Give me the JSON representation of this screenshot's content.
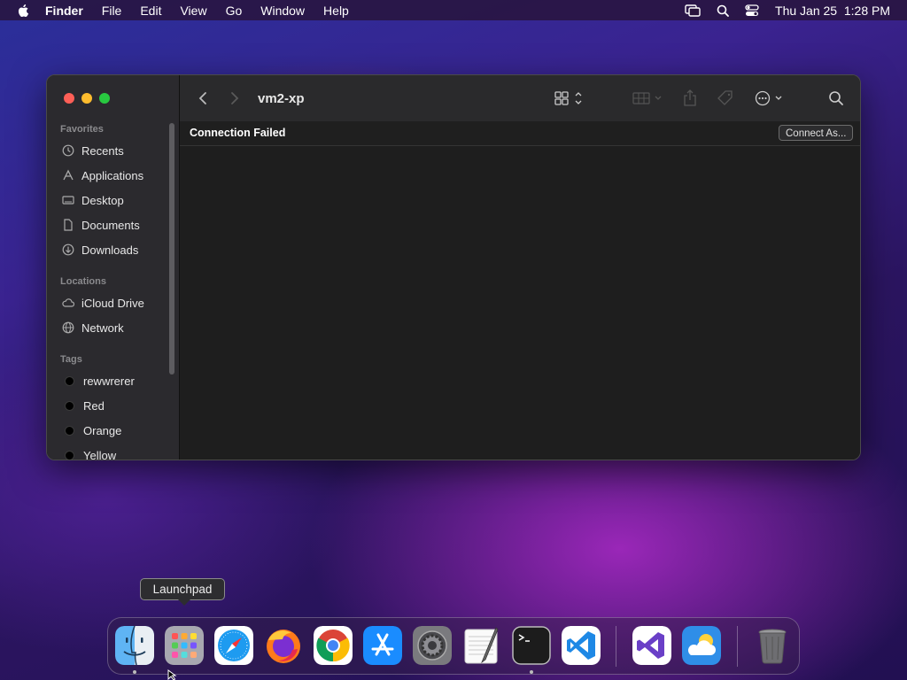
{
  "menubar": {
    "app_name": "Finder",
    "items": [
      "File",
      "Edit",
      "View",
      "Go",
      "Window",
      "Help"
    ],
    "clock": "Thu Jan 25  1:28 PM",
    "status_icons": [
      "screen-mirroring-icon",
      "spotlight-icon",
      "control-center-icon"
    ]
  },
  "window": {
    "title": "vm2-xp",
    "sidebar": {
      "favorites_label": "Favorites",
      "favorites": [
        "Recents",
        "Applications",
        "Desktop",
        "Documents",
        "Downloads"
      ],
      "locations_label": "Locations",
      "locations": [
        "iCloud Drive",
        "Network"
      ],
      "tags_label": "Tags",
      "tags": [
        "rewwrerer",
        "Red",
        "Orange",
        "Yellow"
      ]
    },
    "banner": {
      "message": "Connection Failed",
      "button": "Connect As..."
    }
  },
  "dock": {
    "tooltip": "Launchpad",
    "apps": [
      "Finder",
      "Launchpad",
      "Safari",
      "Firefox",
      "Chrome",
      "App Store",
      "System Preferences",
      "TextEdit",
      "Terminal",
      "Visual Studio Code",
      "Visual Studio",
      "Weather",
      "Trash"
    ]
  },
  "colors": {
    "close": "#fe5f57",
    "minimize": "#febc2e",
    "zoom": "#28c840"
  }
}
